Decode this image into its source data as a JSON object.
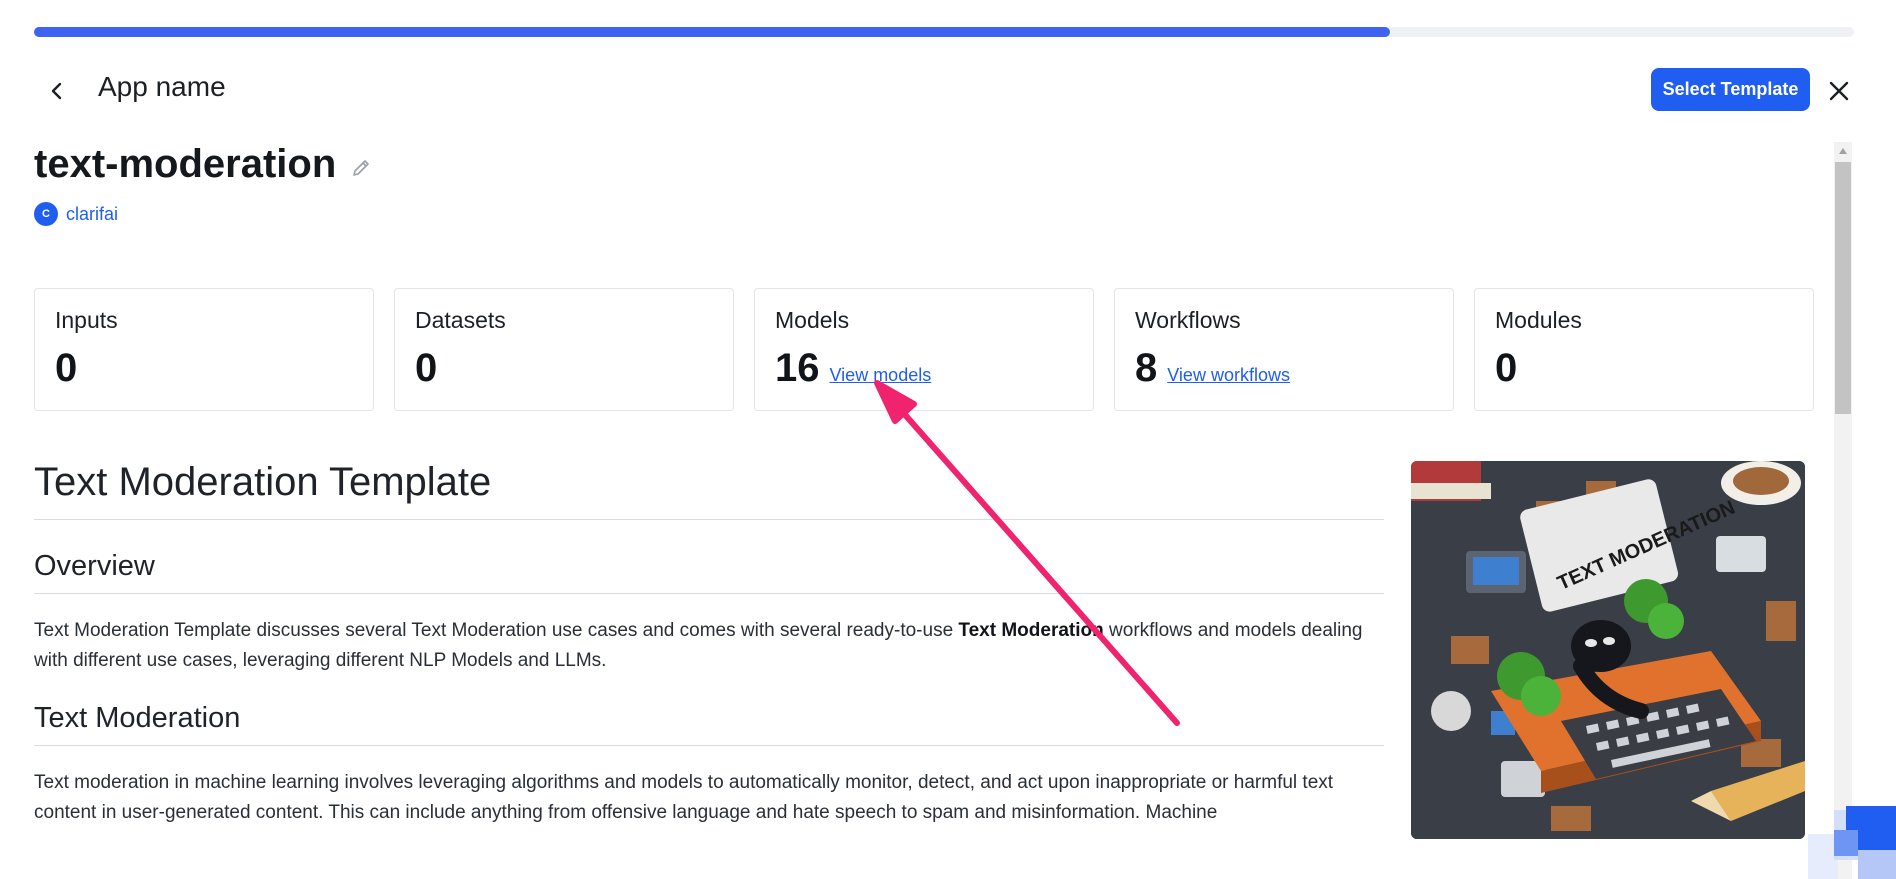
{
  "progress": {
    "fraction": 0.745
  },
  "header": {
    "app_name": "App name",
    "select_template_label": "Select Template"
  },
  "app": {
    "title": "text-moderation",
    "owner_initial": "C",
    "owner_name": "clarifai"
  },
  "stats": [
    {
      "label": "Inputs",
      "value": "0",
      "link": ""
    },
    {
      "label": "Datasets",
      "value": "0",
      "link": ""
    },
    {
      "label": "Models",
      "value": "16",
      "link": "View models"
    },
    {
      "label": "Workflows",
      "value": "8",
      "link": "View workflows"
    },
    {
      "label": "Modules",
      "value": "0",
      "link": ""
    }
  ],
  "content": {
    "heading": "Text Moderation Template",
    "overview_heading": "Overview",
    "overview_text_1": "Text Moderation Template discusses several Text Moderation use cases and comes with several ready-to-use ",
    "overview_bold": "Text Moderation",
    "overview_text_2": " workflows and models dealing with different use cases, leveraging different NLP Models and LLMs.",
    "section_heading": "Text Moderation",
    "section_text": "Text moderation in machine learning involves leveraging algorithms and models to automatically monitor, detect, and act upon inappropriate or harmful text content in user-generated content. This can include anything from offensive language and hate speech to spam and misinformation. Machine"
  },
  "hero": {
    "sign_text": "TEXT MODERATION"
  },
  "colors": {
    "accent": "#1f5ef0",
    "progress": "#3e63f0",
    "annotation_arrow": "#f0246e"
  }
}
